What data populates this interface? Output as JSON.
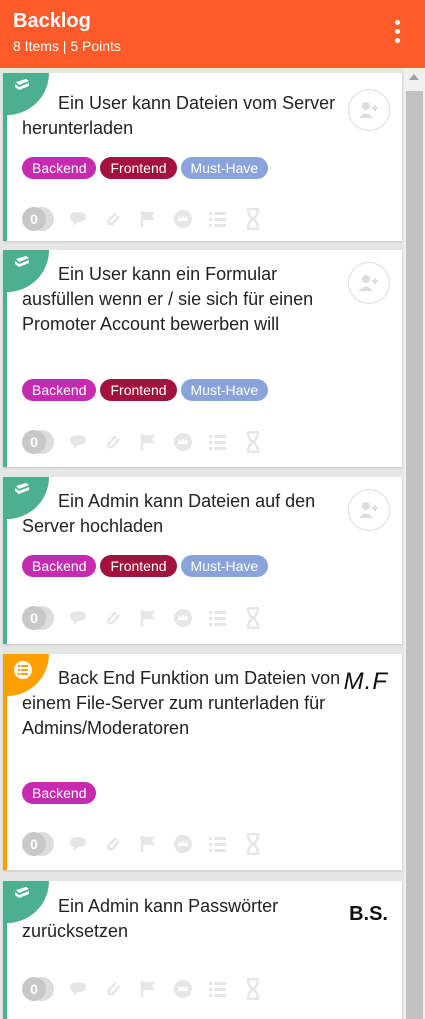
{
  "header": {
    "title": "Backlog",
    "subtitle": "8 Items | 5 Points"
  },
  "colors": {
    "header": "#ff5a2a",
    "story": "#4caf8f",
    "bug": "#ffa000",
    "backend": "#c62ab0",
    "frontend": "#a3113f",
    "must_have": "#8aa3db"
  },
  "cards": [
    {
      "type": "story",
      "icon": "book-icon",
      "title": "Ein User kann Dateien vom Server herunterladen",
      "tags": [
        "Backend",
        "Frontend",
        "Must-Have"
      ],
      "points": "0",
      "assignee": "add-user-icon"
    },
    {
      "type": "story",
      "icon": "book-icon",
      "title": "Ein User kann ein Formular ausfüllen wenn er / sie sich für einen Promoter Account bewerben will",
      "tags": [
        "Backend",
        "Frontend",
        "Must-Have"
      ],
      "points": "0",
      "assignee": "add-user-icon"
    },
    {
      "type": "story",
      "icon": "book-icon",
      "title": "Ein Admin kann Dateien auf den Server hochladen",
      "tags": [
        "Backend",
        "Frontend",
        "Must-Have"
      ],
      "points": "0",
      "assignee": "add-user-icon"
    },
    {
      "type": "task",
      "icon": "list-icon",
      "title": "Back End Funktion um Dateien von einem File-Server zum runterladen für Admins/Moderatoren",
      "tags": [
        "Backend"
      ],
      "points": "0",
      "assignee_text": "M.F"
    },
    {
      "type": "story",
      "icon": "book-icon",
      "title": "Ein Admin kann Passwörter zurücksetzen",
      "tags": [],
      "points": "0",
      "assignee_text": "B.S."
    }
  ]
}
